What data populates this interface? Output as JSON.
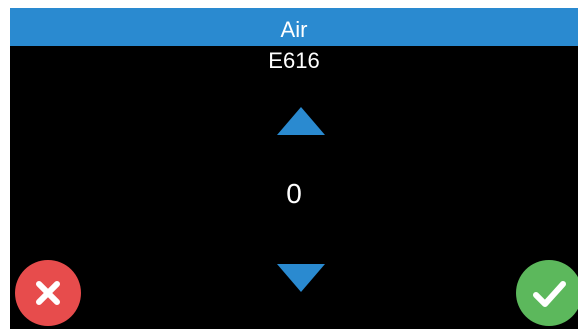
{
  "header": {
    "title": "Air",
    "subtitle": "E616"
  },
  "stepper": {
    "value": "0",
    "increase_icon": "triangle-up-icon",
    "decrease_icon": "triangle-down-icon"
  },
  "actions": {
    "cancel_icon": "close-icon",
    "confirm_icon": "checkmark-icon"
  },
  "colors": {
    "header_bg": "#2a8ad0",
    "arrow": "#2a8ad0",
    "background": "#000000",
    "cancel": "#e74c4c",
    "confirm": "#5cb85c"
  }
}
